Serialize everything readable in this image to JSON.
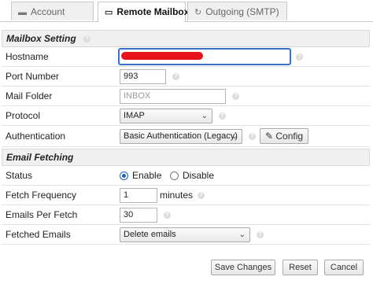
{
  "tabs": [
    {
      "label": "Account",
      "icon": "card-icon"
    },
    {
      "label": "Remote Mailbox",
      "icon": "inbox-icon"
    },
    {
      "label": "Outgoing (SMTP)",
      "icon": "refresh-icon"
    }
  ],
  "mailbox_setting": {
    "title": "Mailbox Setting",
    "hostname": {
      "label": "Hostname",
      "value": ""
    },
    "port": {
      "label": "Port Number",
      "value": "993"
    },
    "folder": {
      "label": "Mail Folder",
      "placeholder": "INBOX"
    },
    "protocol": {
      "label": "Protocol",
      "value": "IMAP"
    },
    "authentication": {
      "label": "Authentication",
      "value": "Basic Authentication (Legacy)",
      "config_label": "Config"
    }
  },
  "email_fetching": {
    "title": "Email Fetching",
    "status": {
      "label": "Status",
      "options": [
        "Enable",
        "Disable"
      ],
      "selected": "Enable"
    },
    "frequency": {
      "label": "Fetch Frequency",
      "value": "1",
      "unit": "minutes"
    },
    "per_fetch": {
      "label": "Emails Per Fetch",
      "value": "30"
    },
    "fetched": {
      "label": "Fetched Emails",
      "value": "Delete emails"
    }
  },
  "actions": {
    "save": "Save Changes",
    "reset": "Reset",
    "cancel": "Cancel"
  },
  "colors": {
    "accent": "#1e5fbf",
    "redaction": "#e8121b"
  }
}
